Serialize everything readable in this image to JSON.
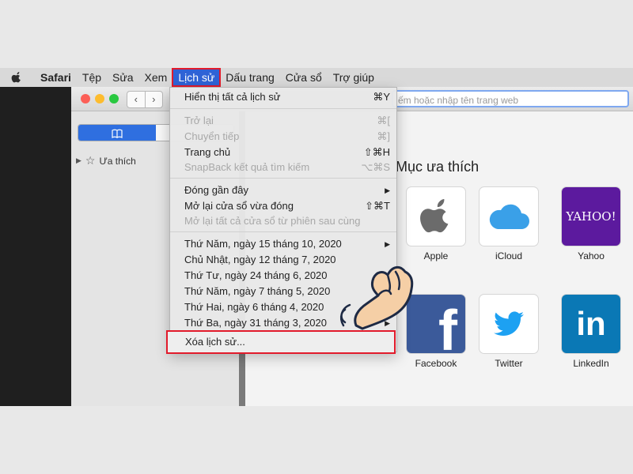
{
  "menubar": {
    "items": [
      "Safari",
      "Tệp",
      "Sửa",
      "Xem",
      "Lịch sử",
      "Dấu trang",
      "Cửa sổ",
      "Trợ giúp"
    ],
    "active": "Lịch sử"
  },
  "toolbar": {
    "back": "‹",
    "forward": "›",
    "address_placeholder": "ếm hoặc nhập tên trang web"
  },
  "sidebar": {
    "favorites_label": "Ưa thích"
  },
  "content": {
    "title": "Mục ưa thích",
    "tiles": [
      {
        "label": "Apple",
        "logo": "apple-logo"
      },
      {
        "label": "iCloud",
        "logo": "icloud-logo"
      },
      {
        "label": "Yahoo",
        "logo": "yahoo-logo",
        "logo_text": "YAHOO!"
      },
      {
        "label": "Facebook",
        "logo": "facebook-logo",
        "logo_text": "f"
      },
      {
        "label": "Twitter",
        "logo": "twitter-logo"
      },
      {
        "label": "LinkedIn",
        "logo": "linkedin-logo",
        "logo_text": "in"
      }
    ]
  },
  "history_menu": {
    "show_all": {
      "label": "Hiển thị tất cả lịch sử",
      "shortcut": "⌘Y"
    },
    "back": {
      "label": "Trở lại",
      "shortcut": "⌘["
    },
    "forward": {
      "label": "Chuyển tiếp",
      "shortcut": "⌘]"
    },
    "home": {
      "label": "Trang chủ",
      "shortcut": "⇧⌘H"
    },
    "snapback": {
      "label": "SnapBack kết quả tìm kiếm",
      "shortcut": "⌥⌘S"
    },
    "recently_closed": {
      "label": "Đóng gần đây"
    },
    "reopen_window": {
      "label": "Mở lại cửa sổ vừa đóng",
      "shortcut": "⇧⌘T"
    },
    "reopen_all": {
      "label": "Mở lại tất cả cửa sổ từ phiên sau cùng"
    },
    "dates": [
      "Thứ Năm, ngày 15 tháng 10, 2020",
      "Chủ Nhật, ngày 12 tháng 7, 2020",
      "Thứ Tư, ngày 24 tháng 6, 2020",
      "Thứ Năm, ngày 7 tháng 5, 2020",
      "Thứ Hai, ngày 6 tháng 4, 2020",
      "Thứ Ba, ngày 31 tháng 3, 2020"
    ],
    "clear_history": "Xóa lịch sử..."
  },
  "colors": {
    "menu_highlight": "#2f63d6",
    "annotation_red": "#e21b2b"
  }
}
